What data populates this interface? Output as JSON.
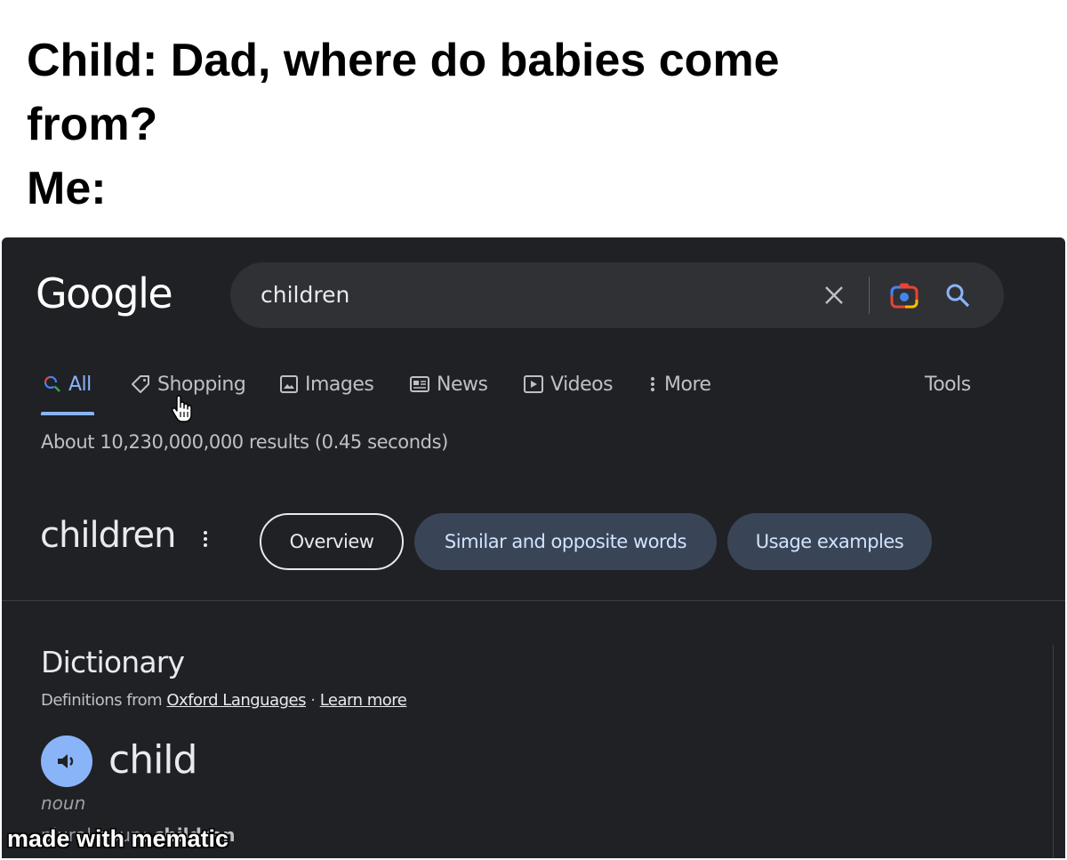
{
  "caption": {
    "line1": "Child: Dad, where do babies come",
    "line2": "from?",
    "line3": "Me:"
  },
  "header": {
    "logo": "Google",
    "search": {
      "value": "children"
    }
  },
  "icons": {
    "clear": "close-icon",
    "lens": "camera-lens-icon",
    "search": "search-icon"
  },
  "tabs": {
    "all": "All",
    "shopping": "Shopping",
    "images": "Images",
    "news": "News",
    "videos": "Videos",
    "more": "More",
    "tools": "Tools"
  },
  "results": {
    "count_text": "About 10,230,000,000 results (0.45 seconds)"
  },
  "entity": {
    "title": "children",
    "chips": {
      "overview": "Overview",
      "similar": "Similar and opposite words",
      "usage": "Usage examples"
    }
  },
  "dictionary": {
    "heading": "Dictionary",
    "source_prefix": "Definitions from",
    "source_link": "Oxford Languages",
    "separator": "·",
    "learn_more": "Learn more",
    "headword": "child",
    "part_of_speech": "noun",
    "plural_label": "plural noun:",
    "plural_value": "children"
  },
  "watermark": "made with mematic",
  "colors": {
    "background": "#202124",
    "searchbar": "#303134",
    "accent": "#8ab4f8",
    "chip": "#394457"
  }
}
